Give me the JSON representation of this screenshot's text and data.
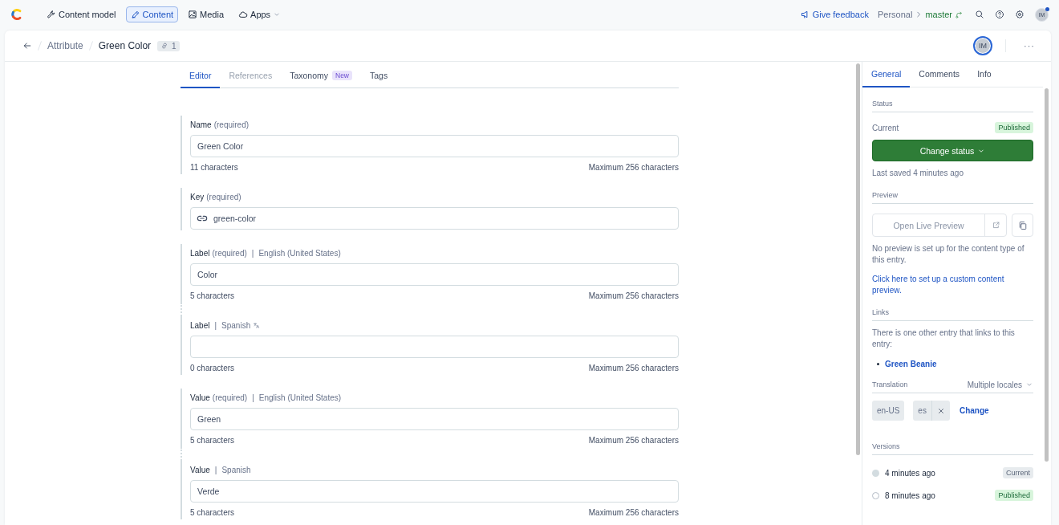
{
  "top_nav": {
    "items": [
      {
        "label": "Content model",
        "selected": false,
        "dropdown": false
      },
      {
        "label": "Content",
        "selected": true,
        "dropdown": false
      },
      {
        "label": "Media",
        "selected": false,
        "dropdown": false
      },
      {
        "label": "Apps",
        "selected": false,
        "dropdown": true
      }
    ],
    "feedback": "Give feedback",
    "space": "Personal",
    "environment": "master",
    "user_initials": "IM"
  },
  "entry_header": {
    "content_type": "Attribute",
    "title": "Green Color",
    "reference_count": "1",
    "user_initials": "IM",
    "more": "···"
  },
  "editor_tabs": [
    {
      "label": "Editor",
      "selected": true,
      "disabled": false
    },
    {
      "label": "References",
      "selected": false,
      "disabled": true
    },
    {
      "label": "Taxonomy",
      "badge": "New",
      "selected": false,
      "disabled": false
    },
    {
      "label": "Tags",
      "selected": false,
      "disabled": false
    }
  ],
  "fields": [
    {
      "label": "Name",
      "note": "(required)",
      "kind": "text",
      "value": "Green Color",
      "counter": "11 characters",
      "limit": "Maximum 256 characters",
      "linked_to_previous": false
    },
    {
      "label": "Key",
      "note": "(required)",
      "kind": "slug",
      "value": "green-color",
      "linked_to_previous": false
    },
    {
      "label": "Label",
      "note": "(required)",
      "separator": "|",
      "locale": "English (United States)",
      "kind": "text",
      "value": "Color",
      "counter": "5 characters",
      "limit": "Maximum 256 characters",
      "linked_to_previous": false,
      "locale_icon": false
    },
    {
      "label": "Label",
      "separator": "|",
      "locale": "Spanish",
      "kind": "text",
      "counter": "0 characters",
      "limit": "Maximum 256 characters",
      "linked_to_previous": true,
      "locale_icon": true
    },
    {
      "label": "Value",
      "note": "(required)",
      "separator": "|",
      "locale": "English (United States)",
      "kind": "text",
      "value": "Green",
      "counter": "5 characters",
      "limit": "Maximum 256 characters",
      "linked_to_previous": false,
      "locale_icon": false
    },
    {
      "label": "Value",
      "separator": "|",
      "locale": "Spanish",
      "kind": "text",
      "value": "Verde",
      "counter": "5 characters",
      "limit": "Maximum 256 characters",
      "linked_to_previous": true,
      "locale_icon": false
    }
  ],
  "sidebar": {
    "tabs": [
      {
        "label": "General",
        "selected": true
      },
      {
        "label": "Comments",
        "selected": false
      },
      {
        "label": "Info",
        "selected": false
      }
    ],
    "status": {
      "heading": "Status",
      "current_label": "Current",
      "current_badge": "Published",
      "button": "Change status",
      "last_saved": "Last saved 4 minutes ago"
    },
    "preview": {
      "heading": "Preview",
      "button": "Open Live Preview",
      "note": "No preview is set up for the content type of this entry.",
      "link": "Click here to set up a custom content preview."
    },
    "links": {
      "heading": "Links",
      "text": "There is one other entry that links to this entry:",
      "entries": [
        "Green Beanie"
      ]
    },
    "translation": {
      "heading": "Translation",
      "mode": "Multiple locales",
      "locales": [
        {
          "code": "en-US",
          "removable": false
        },
        {
          "code": "es",
          "removable": true
        }
      ],
      "change": "Change"
    },
    "versions": {
      "heading": "Versions",
      "items": [
        {
          "time": "4 minutes ago",
          "badge": "Current",
          "kind": "current"
        },
        {
          "time": "8 minutes ago",
          "badge": "Published",
          "kind": "published"
        }
      ]
    }
  }
}
